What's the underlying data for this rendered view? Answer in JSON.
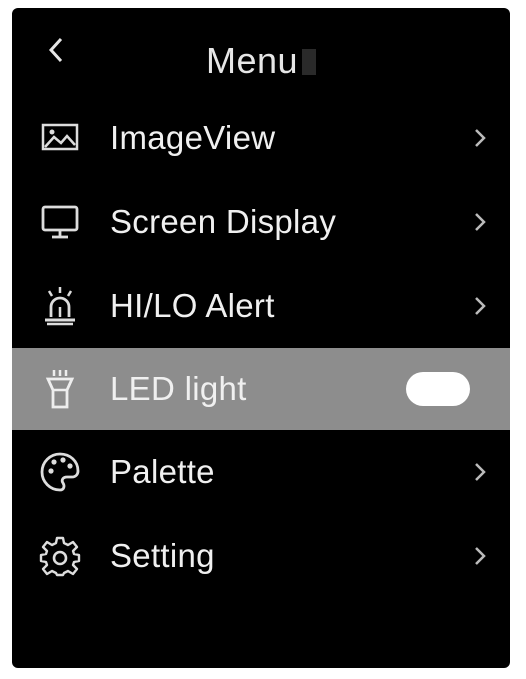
{
  "header": {
    "title": "Menu"
  },
  "menu": {
    "items": [
      {
        "label": "ImageView",
        "icon": "image-icon"
      },
      {
        "label": "Screen Display",
        "icon": "monitor-icon"
      },
      {
        "label": "HI/LO Alert",
        "icon": "alarm-icon"
      },
      {
        "label": "LED light",
        "icon": "flashlight-icon",
        "toggle_on": true
      },
      {
        "label": "Palette",
        "icon": "palette-icon"
      },
      {
        "label": "Setting",
        "icon": "gear-icon"
      }
    ]
  },
  "colors": {
    "background": "#000000",
    "highlight": "#8d8d8d",
    "text": "#f0f0f0"
  }
}
